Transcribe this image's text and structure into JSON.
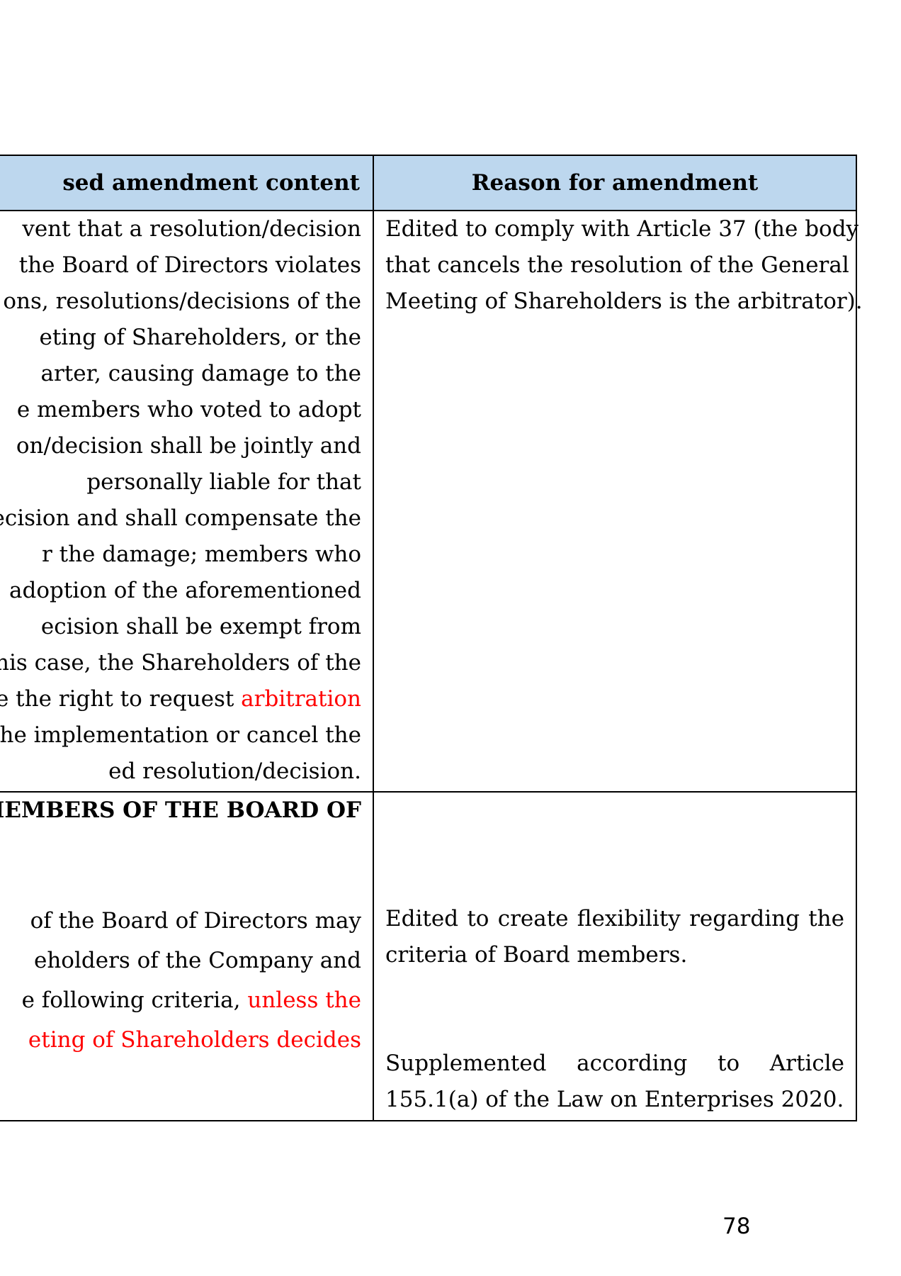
{
  "table": {
    "header": {
      "left": "sed amendment content",
      "right": "Reason for amendment"
    },
    "row1": {
      "left_lines": [
        "vent that a resolution/decision",
        "the Board of Directors violates",
        "ons, resolutions/decisions of the",
        "eting of Shareholders, or the",
        "arter, causing damage to the",
        "e members who voted to adopt",
        "on/decision shall be jointly and",
        "personally liable for that",
        "ecision and shall compensate the",
        "r the damage; members who",
        "adoption of the aforementioned",
        "ecision shall be exempt from",
        "his case, the Shareholders of the"
      ],
      "left_line14_a": "e the right to request ",
      "left_line14_red": "arbitration",
      "left_line15": "he implementation or cancel the",
      "left_line16": "ed resolution/decision.",
      "right_lines": [
        "Edited to comply with Article 37 (the body",
        "that cancels the resolution of the General",
        "Meeting of Shareholders is the arbitrator)."
      ]
    },
    "row2": {
      "left_heading": " MEMBERS OF THE BOARD OF",
      "left_lines": [
        "of the Board of Directors may",
        "eholders of the Company and"
      ],
      "left_line3_a": "e following criteria, ",
      "left_line3_red": "unless the",
      "left_line4_red": "eting of Shareholders decides",
      "right_block1": [
        "Edited to create flexibility regarding the",
        "criteria of Board members."
      ],
      "right_block2": [
        "Supplemented according to Article",
        "155.1(a) of the Law on Enterprises 2020."
      ]
    }
  },
  "page_number": "78"
}
